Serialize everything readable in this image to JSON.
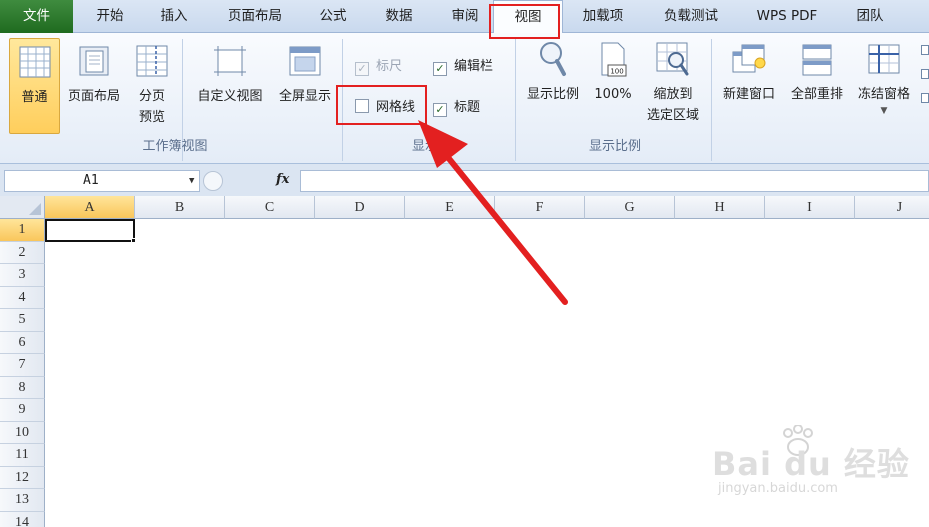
{
  "tabs": [
    {
      "label": "文件"
    },
    {
      "label": "开始"
    },
    {
      "label": "插入"
    },
    {
      "label": "页面布局"
    },
    {
      "label": "公式"
    },
    {
      "label": "数据"
    },
    {
      "label": "审阅"
    },
    {
      "label": "视图"
    },
    {
      "label": "加载项"
    },
    {
      "label": "负载测试"
    },
    {
      "label": "WPS PDF"
    },
    {
      "label": "团队"
    }
  ],
  "active_tab": "视图",
  "ribbon": {
    "workbook_views": {
      "group_label": "工作簿视图",
      "normal": "普通",
      "page_layout": "页面布局",
      "page_break_1": "分页",
      "page_break_2": "预览",
      "custom_views": "自定义视图",
      "full_screen": "全屏显示"
    },
    "show": {
      "group_label": "显示",
      "ruler": "标尺",
      "formula_bar": "编辑栏",
      "gridlines": "网格线",
      "headings": "标题",
      "ruler_checked": true,
      "formula_bar_checked": true,
      "gridlines_checked": false,
      "headings_checked": true
    },
    "zoom": {
      "group_label": "显示比例",
      "zoom": "显示比例",
      "hundred": "100%",
      "zoom_sel_1": "缩放到",
      "zoom_sel_2": "选定区域",
      "hundred_icon_text": "100"
    },
    "window": {
      "new_window": "新建窗口",
      "arrange_all": "全部重排",
      "freeze_panes": "冻结窗格"
    }
  },
  "formula_bar": {
    "name_box": "A1",
    "fx": "fx"
  },
  "columns": [
    "A",
    "B",
    "C",
    "D",
    "E",
    "F",
    "G",
    "H",
    "I",
    "J"
  ],
  "rows": [
    "1",
    "2",
    "3",
    "4",
    "5",
    "6",
    "7",
    "8",
    "9",
    "10",
    "11",
    "12",
    "13",
    "14"
  ],
  "selected_cell": "A1",
  "watermark": {
    "brand": "Bai du 经验",
    "url": "jingyan.baidu.com"
  },
  "colors": {
    "annotation_red": "#e32020",
    "file_tab_green": "#2a7a2a",
    "ribbon_bg": "#eef3fa"
  }
}
